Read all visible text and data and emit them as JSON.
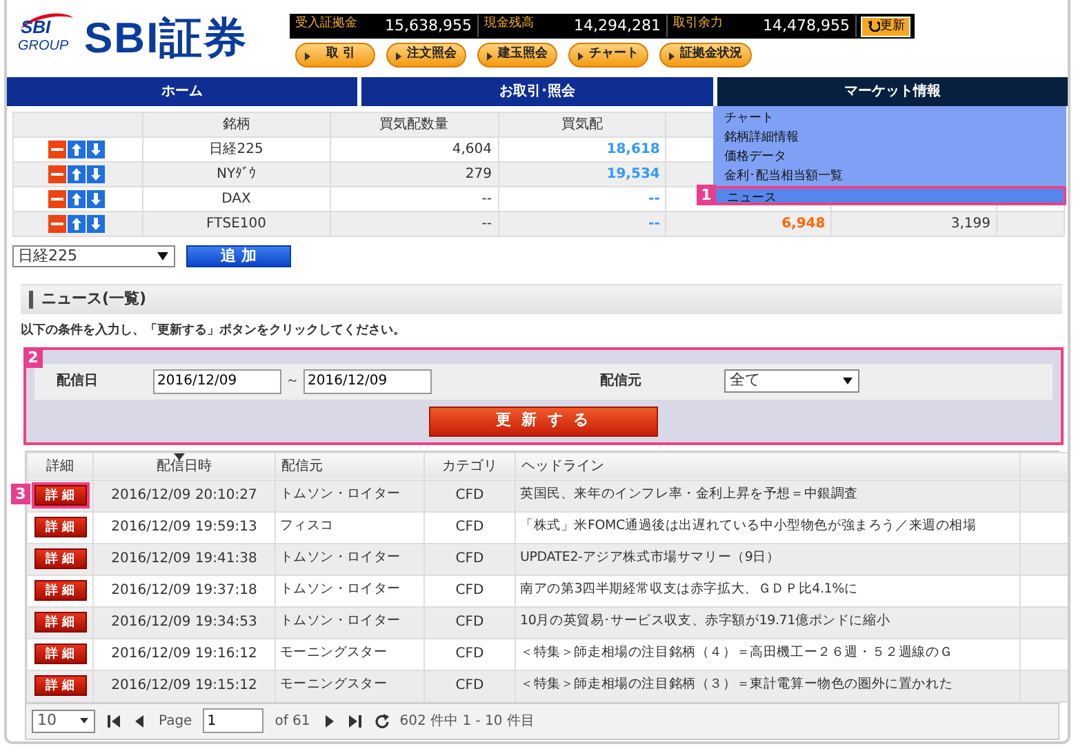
{
  "header": {
    "logo": {
      "group": "SBI",
      "sub": "GROUP",
      "name": "SBI証券"
    },
    "account": [
      {
        "label": "受入証拠金",
        "value": "15,638,955"
      },
      {
        "label": "現金残高",
        "value": "14,294,281"
      },
      {
        "label": "取引余力",
        "value": "14,478,955"
      }
    ],
    "refresh_button": "更新",
    "buttons": [
      "取 引",
      "注文照会",
      "建玉照会",
      "チャート",
      "証拠金状況"
    ]
  },
  "nav": [
    {
      "label": "ホーム",
      "selected": false
    },
    {
      "label": "お取引･照会",
      "selected": false
    },
    {
      "label": "マーケット情報",
      "selected": true
    }
  ],
  "market_menu": [
    {
      "label": "チャート",
      "selected": false
    },
    {
      "label": "銘柄詳細情報",
      "selected": false
    },
    {
      "label": "価格データ",
      "selected": false
    },
    {
      "label": "金利･配当相当額一覧",
      "selected": false
    },
    {
      "label": "ニュース",
      "selected": true,
      "callout": "1"
    }
  ],
  "quotes": {
    "columns": [
      "銘柄",
      "買気配数量",
      "買気配"
    ],
    "rows": [
      {
        "name": "日経225",
        "qty": "4,604",
        "bid": "18,618"
      },
      {
        "name": "NYﾀﾞｳ",
        "qty": "279",
        "bid": "19,534"
      },
      {
        "name": "DAX",
        "qty": "--",
        "bid": "--"
      },
      {
        "name": "FTSE100",
        "qty": "--",
        "bid": "--",
        "column_4": "6,948",
        "column_5": "3,199"
      }
    ]
  },
  "add_row": {
    "select": "日経225",
    "button": "追 加"
  },
  "section_title": "ニュース(一覧)",
  "instruction": "以下の条件を入力し、「更新する」ボタンをクリックしてください。",
  "filter": {
    "callout": "2",
    "date_label": "配信日",
    "date_from": "2016/12/09",
    "separator": "～",
    "date_to": "2016/12/09",
    "source_label": "配信元",
    "source": "全て",
    "submit": "更 新 す る"
  },
  "news": {
    "columns": [
      "詳細",
      "配信日時",
      "配信元",
      "カテゴリ",
      "ヘッドライン"
    ],
    "callout": "3",
    "rows": [
      {
        "detail": "詳 細",
        "time": "2016/12/09 20:10:27",
        "source": "トムソン・ロイター",
        "category": "CFD",
        "headline": "英国民、来年のインフレ率・金利上昇を予想＝中銀調査"
      },
      {
        "detail": "詳 細",
        "time": "2016/12/09 19:59:13",
        "source": "フィスコ",
        "category": "CFD",
        "headline": "「株式」米FOMC通過後は出遅れている中小型物色が強まろう／来週の相場"
      },
      {
        "detail": "詳 細",
        "time": "2016/12/09 19:41:38",
        "source": "トムソン・ロイター",
        "category": "CFD",
        "headline": "UPDATE2-アジア株式市場サマリー（9日）"
      },
      {
        "detail": "詳 細",
        "time": "2016/12/09 19:37:18",
        "source": "トムソン・ロイター",
        "category": "CFD",
        "headline": "南アの第3四半期経常収支は赤字拡大、ＧＤＰ比4.1%に"
      },
      {
        "detail": "詳 細",
        "time": "2016/12/09 19:34:53",
        "source": "トムソン・ロイター",
        "category": "CFD",
        "headline": "10月の英貿易･サービス収支、赤字額が19.71億ポンドに縮小"
      },
      {
        "detail": "詳 細",
        "time": "2016/12/09 19:16:12",
        "source": "モーニングスター",
        "category": "CFD",
        "headline": "＜特集＞師走相場の注目銘柄（４）＝高田機工ー２６週・５２週線のＧ"
      },
      {
        "detail": "詳 細",
        "time": "2016/12/09 19:15:12",
        "source": "モーニングスター",
        "category": "CFD",
        "headline": "＜特集＞師走相場の注目銘柄（３）＝東計電算ー物色の圏外に置かれた"
      }
    ],
    "pager": {
      "page_size": "10",
      "page_label": "Page",
      "page": "1",
      "of": "of 61",
      "summary": "602 件中 1 - 10 件目"
    }
  }
}
